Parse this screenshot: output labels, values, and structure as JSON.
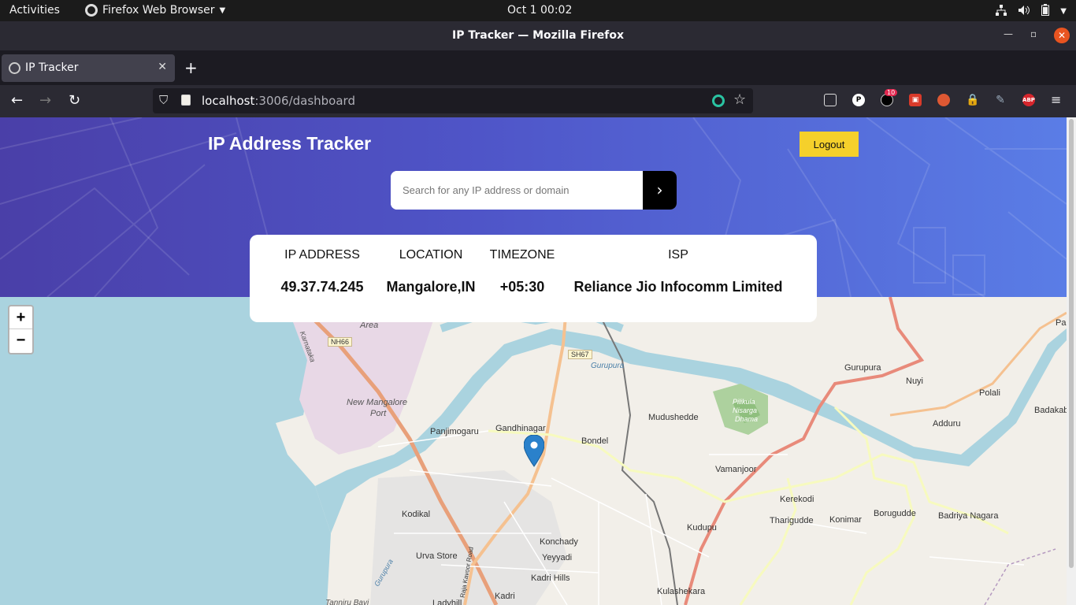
{
  "system": {
    "activities": "Activities",
    "app_name": "Firefox Web Browser",
    "clock": "Oct 1  00:02"
  },
  "window": {
    "title": "IP Tracker — Mozilla Firefox"
  },
  "tabs": [
    {
      "label": "IP Tracker"
    }
  ],
  "navbar": {
    "url_host": "localhost",
    "url_rest": ":3006/dashboard",
    "badge_count": "10"
  },
  "app": {
    "brand": "IP Address Tracker",
    "logout_label": "Logout",
    "search_placeholder": "Search for any IP address or domain",
    "search_value": "",
    "info": {
      "ip_label": "IP ADDRESS",
      "ip_value": "49.37.74.245",
      "location_label": "LOCATION",
      "location_value": "Mangalore,IN",
      "timezone_label": "TIMEZONE",
      "timezone_value": "+05:30",
      "isp_label": "ISP",
      "isp_value": "Reliance Jio Infocomm Limited"
    }
  },
  "map": {
    "zoom_in": "+",
    "zoom_out": "−",
    "labels": {
      "area": "Area",
      "karnataka": "Karnataka",
      "nh66": "NH66",
      "sh67": "SH67",
      "gurupura_river": "Gurupura",
      "new_mangalore": "New Mangalore",
      "port": "Port",
      "panjimogaru": "Panjimogaru",
      "gandhinagar": "Gandhinagar",
      "bondel": "Bondel",
      "mudushedde": "Mudushedde",
      "pilikula": "Pilikula",
      "nisarga": "Nisarga",
      "dhama": "Dhama",
      "gurupura": "Gurupura",
      "nuyi": "Nuyi",
      "polali": "Polali",
      "adduru": "Adduru",
      "badakab": "Badakab",
      "pal": "Pal",
      "vamanjoor": "Vamanjoor",
      "kerekodi": "Kerekodi",
      "tharigudde": "Tharigudde",
      "konimar": "Konimar",
      "borugudde": "Borugudde",
      "badriya_nagara": "Badriya Nagara",
      "kodikal": "Kodikal",
      "kudupu": "Kudupu",
      "konchady": "Konchady",
      "yeyyadi": "Yeyyadi",
      "urva_store": "Urva Store",
      "kadri_hills": "Kadri Hills",
      "kulashekara": "Kulashekara",
      "kadri": "Kadri",
      "ladyhill": "Ladyhill",
      "tannirubavi": "Tanniru Bavi",
      "gurupura_river2": "Gurupura",
      "kavoor_road": "Raja Kavoor Road"
    }
  },
  "colors": {
    "accent_yellow": "#f5d02b",
    "hero_start": "#4a3fa8",
    "hero_end": "#5a7de6",
    "marker": "#2a81cb"
  }
}
